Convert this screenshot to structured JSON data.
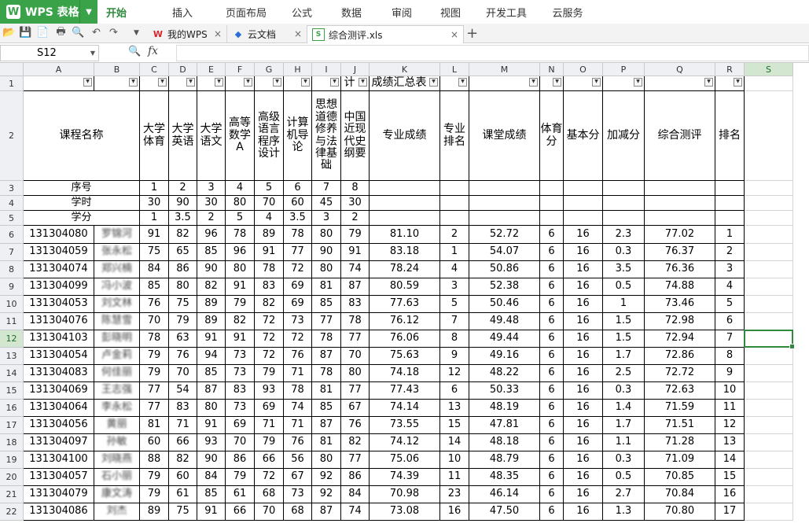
{
  "app": {
    "name": "WPS 表格",
    "menu_tabs": [
      "开始",
      "插入",
      "页面布局",
      "公式",
      "数据",
      "审阅",
      "视图",
      "开发工具",
      "云服务"
    ],
    "doc_tabs": [
      {
        "label": "我的WPS",
        "icon": "wps-logo-icon"
      },
      {
        "label": "云文档",
        "icon": "cloud-doc-icon"
      },
      {
        "label": "综合测评.xls",
        "icon": "spreadsheet-icon"
      }
    ],
    "accent_color": "#3aa34a"
  },
  "formula_bar": {
    "name_box": "S12",
    "fx_label": "fx",
    "formula": ""
  },
  "sheet": {
    "columns": [
      "A",
      "B",
      "C",
      "D",
      "E",
      "F",
      "G",
      "H",
      "I",
      "J",
      "K",
      "L",
      "M",
      "N",
      "O",
      "P",
      "Q",
      "R",
      "S"
    ],
    "selected_column": "S",
    "selected_row": "12",
    "row_numbers": [
      "1",
      "2",
      "3",
      "4",
      "5",
      "6",
      "7",
      "8",
      "9",
      "10",
      "11",
      "12",
      "13",
      "14",
      "15",
      "16",
      "17",
      "18",
      "19",
      "20",
      "21",
      "22"
    ],
    "row1_title": "成绩汇总表",
    "row1_fragment": "计",
    "headers": [
      "课程名称",
      "",
      "大学体育",
      "大学英语",
      "大学语文",
      "高等数学A",
      "高级语言程序设计",
      "计算机导论",
      "思想道德修养与法律基础",
      "中国近现代史纲要",
      "专业成绩",
      "专业排名",
      "课堂成绩",
      "体育分",
      "基本分",
      "加减分",
      "综合测评",
      "排名"
    ],
    "info_rows": [
      {
        "label": "序号",
        "values": [
          "1",
          "2",
          "3",
          "4",
          "5",
          "6",
          "7",
          "8"
        ]
      },
      {
        "label": "学时",
        "values": [
          "30",
          "90",
          "30",
          "80",
          "70",
          "60",
          "45",
          "30"
        ]
      },
      {
        "label": "学分",
        "values": [
          "1",
          "3.5",
          "2",
          "5",
          "4",
          "3.5",
          "3",
          "2"
        ]
      }
    ],
    "students": [
      {
        "id": "131304080",
        "name": "罗锦河",
        "scores": [
          "91",
          "82",
          "96",
          "78",
          "89",
          "78",
          "80",
          "79"
        ],
        "major": "81.10",
        "major_rank": "2",
        "class": "52.72",
        "pe": "6",
        "base": "16",
        "adj": "2.3",
        "total": "77.02",
        "rank": "1"
      },
      {
        "id": "131304059",
        "name": "张永松",
        "scores": [
          "75",
          "65",
          "85",
          "96",
          "91",
          "77",
          "90",
          "91"
        ],
        "major": "83.18",
        "major_rank": "1",
        "class": "54.07",
        "pe": "6",
        "base": "16",
        "adj": "0.3",
        "total": "76.37",
        "rank": "2"
      },
      {
        "id": "131304074",
        "name": "郑兴楠",
        "scores": [
          "84",
          "86",
          "90",
          "80",
          "78",
          "72",
          "80",
          "74"
        ],
        "major": "78.24",
        "major_rank": "4",
        "class": "50.86",
        "pe": "6",
        "base": "16",
        "adj": "3.5",
        "total": "76.36",
        "rank": "3"
      },
      {
        "id": "131304099",
        "name": "冯小波",
        "scores": [
          "85",
          "80",
          "82",
          "91",
          "83",
          "69",
          "81",
          "87"
        ],
        "major": "80.59",
        "major_rank": "3",
        "class": "52.38",
        "pe": "6",
        "base": "16",
        "adj": "0.5",
        "total": "74.88",
        "rank": "4"
      },
      {
        "id": "131304053",
        "name": "刘文林",
        "scores": [
          "76",
          "75",
          "89",
          "79",
          "82",
          "69",
          "85",
          "83"
        ],
        "major": "77.63",
        "major_rank": "5",
        "class": "50.46",
        "pe": "6",
        "base": "16",
        "adj": "1",
        "total": "73.46",
        "rank": "5"
      },
      {
        "id": "131304076",
        "name": "陈慧雪",
        "scores": [
          "70",
          "79",
          "89",
          "82",
          "72",
          "73",
          "77",
          "78"
        ],
        "major": "76.12",
        "major_rank": "7",
        "class": "49.48",
        "pe": "6",
        "base": "16",
        "adj": "1.5",
        "total": "72.98",
        "rank": "6"
      },
      {
        "id": "131304103",
        "name": "彭晓明",
        "scores": [
          "78",
          "63",
          "91",
          "91",
          "72",
          "72",
          "78",
          "77"
        ],
        "major": "76.06",
        "major_rank": "8",
        "class": "49.44",
        "pe": "6",
        "base": "16",
        "adj": "1.5",
        "total": "72.94",
        "rank": "7"
      },
      {
        "id": "131304054",
        "name": "卢金莉",
        "scores": [
          "79",
          "76",
          "94",
          "73",
          "72",
          "76",
          "87",
          "70"
        ],
        "major": "75.63",
        "major_rank": "9",
        "class": "49.16",
        "pe": "6",
        "base": "16",
        "adj": "1.7",
        "total": "72.86",
        "rank": "8"
      },
      {
        "id": "131304083",
        "name": "何佳丽",
        "scores": [
          "79",
          "70",
          "85",
          "73",
          "79",
          "71",
          "78",
          "80"
        ],
        "major": "74.18",
        "major_rank": "12",
        "class": "48.22",
        "pe": "6",
        "base": "16",
        "adj": "2.5",
        "total": "72.72",
        "rank": "9"
      },
      {
        "id": "131304069",
        "name": "王志强",
        "scores": [
          "77",
          "54",
          "87",
          "83",
          "93",
          "78",
          "81",
          "77"
        ],
        "major": "77.43",
        "major_rank": "6",
        "class": "50.33",
        "pe": "6",
        "base": "16",
        "adj": "0.3",
        "total": "72.63",
        "rank": "10"
      },
      {
        "id": "131304064",
        "name": "李永松",
        "scores": [
          "77",
          "83",
          "80",
          "73",
          "69",
          "74",
          "85",
          "67"
        ],
        "major": "74.14",
        "major_rank": "13",
        "class": "48.19",
        "pe": "6",
        "base": "16",
        "adj": "1.4",
        "total": "71.59",
        "rank": "11"
      },
      {
        "id": "131304056",
        "name": "黄丽",
        "scores": [
          "81",
          "71",
          "91",
          "69",
          "71",
          "71",
          "87",
          "76"
        ],
        "major": "73.55",
        "major_rank": "15",
        "class": "47.81",
        "pe": "6",
        "base": "16",
        "adj": "1.7",
        "total": "71.51",
        "rank": "12"
      },
      {
        "id": "131304097",
        "name": "孙敏",
        "scores": [
          "60",
          "66",
          "93",
          "70",
          "79",
          "76",
          "81",
          "82"
        ],
        "major": "74.12",
        "major_rank": "14",
        "class": "48.18",
        "pe": "6",
        "base": "16",
        "adj": "1.1",
        "total": "71.28",
        "rank": "13"
      },
      {
        "id": "131304100",
        "name": "刘晓燕",
        "scores": [
          "88",
          "82",
          "90",
          "86",
          "66",
          "56",
          "80",
          "77"
        ],
        "major": "75.06",
        "major_rank": "10",
        "class": "48.79",
        "pe": "6",
        "base": "16",
        "adj": "0.3",
        "total": "71.09",
        "rank": "14"
      },
      {
        "id": "131304057",
        "name": "石小丽",
        "scores": [
          "79",
          "60",
          "84",
          "79",
          "72",
          "67",
          "92",
          "86"
        ],
        "major": "74.39",
        "major_rank": "11",
        "class": "48.35",
        "pe": "6",
        "base": "16",
        "adj": "0.5",
        "total": "70.85",
        "rank": "15"
      },
      {
        "id": "131304079",
        "name": "康文涛",
        "scores": [
          "79",
          "61",
          "85",
          "61",
          "68",
          "73",
          "92",
          "84"
        ],
        "major": "70.98",
        "major_rank": "23",
        "class": "46.14",
        "pe": "6",
        "base": "16",
        "adj": "2.7",
        "total": "70.84",
        "rank": "16"
      },
      {
        "id": "131304086",
        "name": "刘杰",
        "scores": [
          "89",
          "75",
          "91",
          "66",
          "70",
          "68",
          "87",
          "74"
        ],
        "major": "73.08",
        "major_rank": "16",
        "class": "47.50",
        "pe": "6",
        "base": "16",
        "adj": "1.3",
        "total": "70.80",
        "rank": "17"
      }
    ]
  }
}
